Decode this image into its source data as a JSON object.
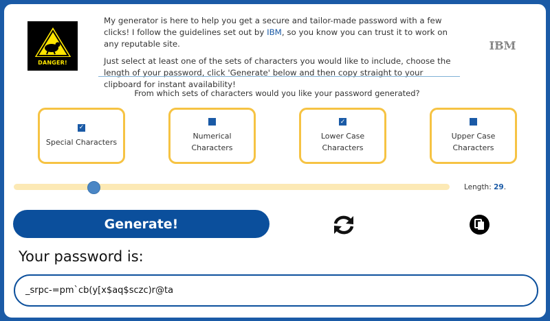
{
  "logo": {
    "text": "DANGER!"
  },
  "intro": {
    "p1_before": "My generator is here to help you get a secure and tailor-made password with a few clicks! I follow the guidelines set out by ",
    "p1_link": "IBM",
    "p1_after": ", so you know you can trust it to work on any reputable site.",
    "p2": "Just select at least one of the sets of characters you would like to include, choose the length of your password, click 'Generate' below and then copy straight to your clipboard for instant availability!"
  },
  "brand": {
    "name": "IBM"
  },
  "question": "From which sets of characters would you like your password generated?",
  "options": [
    {
      "label": "Special Characters",
      "checked": true
    },
    {
      "label": "Numerical Characters",
      "checked": false
    },
    {
      "label": "Lower Case Characters",
      "checked": true
    },
    {
      "label": "Upper Case Characters",
      "checked": false
    }
  ],
  "length": {
    "label": "Length: ",
    "value": "29",
    "suffix": "."
  },
  "generate_label": "Generate!",
  "icons": {
    "refresh": "refresh-icon",
    "copy": "copy-icon"
  },
  "password": {
    "title": "Your password is:",
    "value": "_srpc-=pm`cb(y[x$aq$sczc)r@ta"
  },
  "colors": {
    "primary": "#0b4f9c",
    "accent": "#f6c343",
    "track": "#fce9b5"
  }
}
